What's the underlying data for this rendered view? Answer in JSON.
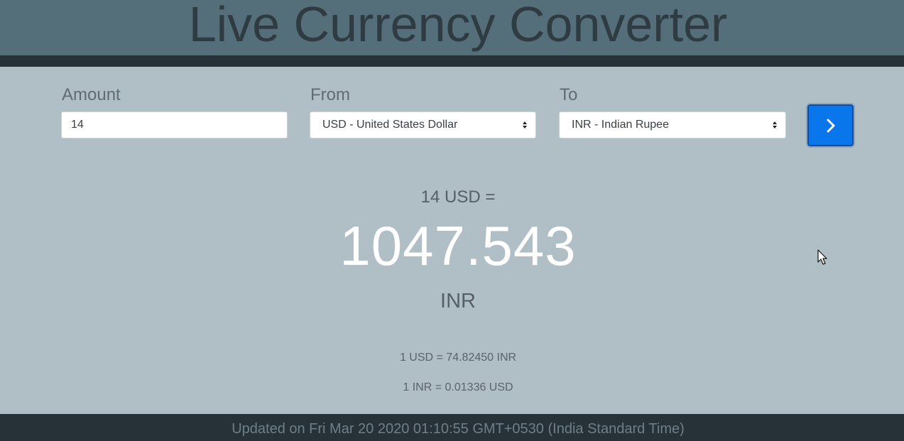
{
  "header": {
    "title": "Live Currency Converter"
  },
  "form": {
    "amount": {
      "label": "Amount",
      "value": "14"
    },
    "from": {
      "label": "From",
      "selected": "USD - United States Dollar"
    },
    "to": {
      "label": "To",
      "selected": "INR - Indian Rupee"
    },
    "submit_icon": "chevron-right-icon"
  },
  "result": {
    "from_text": "14 USD =",
    "value": "1047.543",
    "to_currency": "INR"
  },
  "rates": {
    "forward": "1 USD = 74.82450 INR",
    "reverse": "1 INR = 0.01336 USD"
  },
  "footer": {
    "updated": "Updated on Fri Mar 20 2020 01:10:55 GMT+0530 (India Standard Time)"
  },
  "colors": {
    "background": "#b0bec5",
    "header": "#546e7a",
    "dark_bar": "#263238",
    "accent": "#0a76ec"
  }
}
